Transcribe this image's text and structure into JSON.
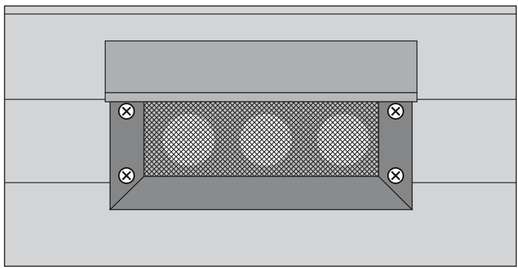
{
  "illustration": {
    "subject": "speaker-grille-panel",
    "colors": {
      "wall": "#d3d4d6",
      "wall_stroke": "#1a1a1a",
      "hood_top": "#aeafb1",
      "hood_lip": "#b7b8ba",
      "frame": "#8e8f91",
      "frame_bevel_dark": "#7a7b7d",
      "frame_bevel_light": "#9a9b9d",
      "mesh_bg": "#bcbdbf",
      "mesh_line": "#2b2b2b",
      "cone_fill": "#ffffff",
      "screw_fill": "#ffffff"
    },
    "screws": [
      {
        "name": "screw-top-left-icon"
      },
      {
        "name": "screw-top-right-icon"
      },
      {
        "name": "screw-bottom-left-icon"
      },
      {
        "name": "screw-bottom-right-icon"
      }
    ],
    "speaker_cones": [
      {
        "name": "speaker-cone-left"
      },
      {
        "name": "speaker-cone-center"
      },
      {
        "name": "speaker-cone-right"
      }
    ]
  }
}
